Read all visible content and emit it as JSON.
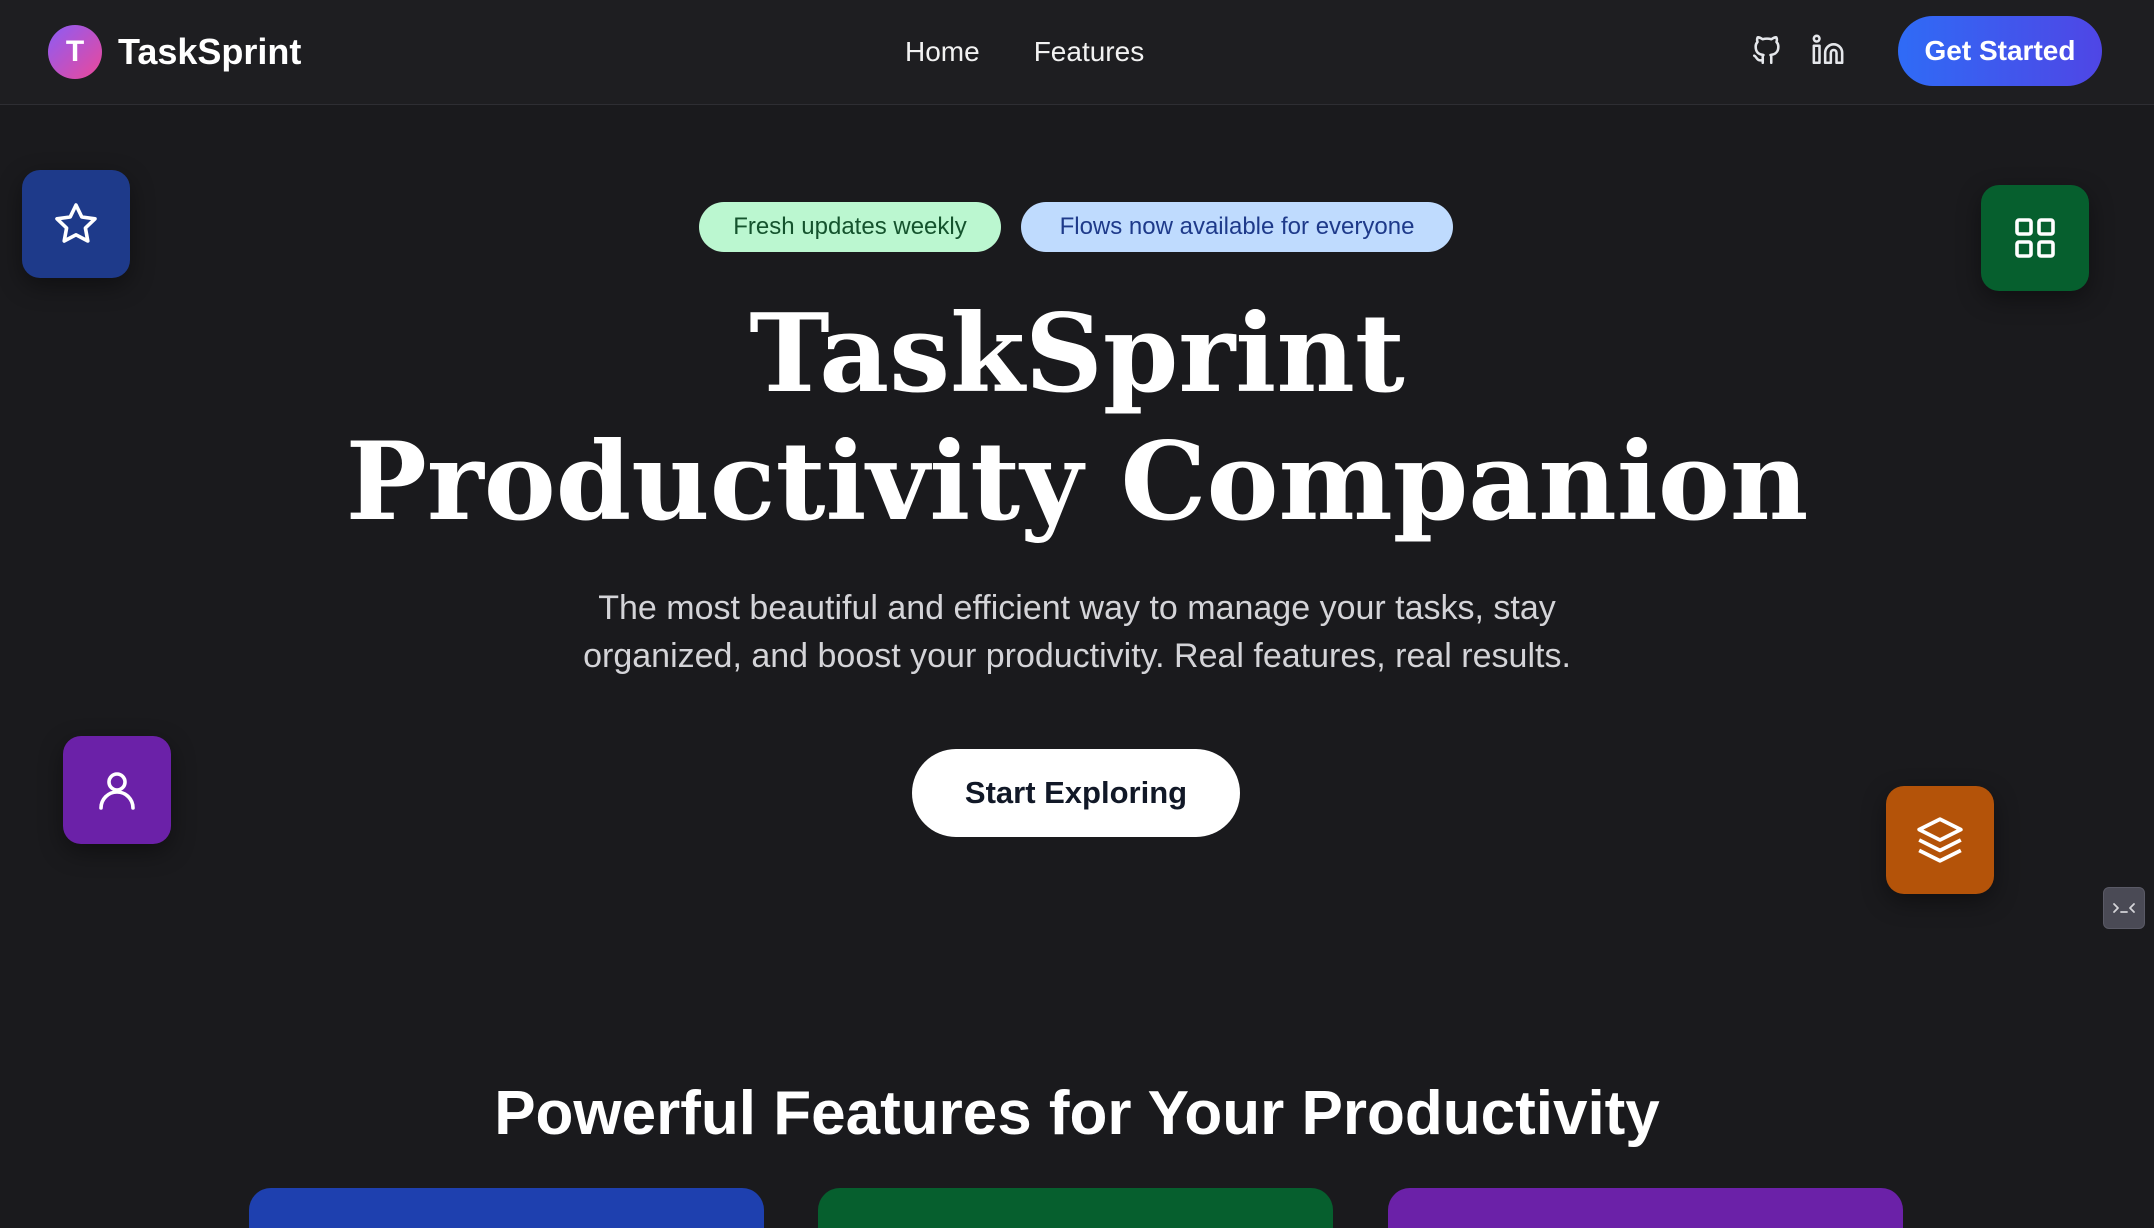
{
  "header": {
    "logo_letter": "T",
    "brand": "TaskSprint",
    "nav": [
      "Home",
      "Features"
    ],
    "icons": [
      "github-icon",
      "linkedin-icon"
    ],
    "cta_label": "Get Started"
  },
  "hero": {
    "badges": [
      {
        "label": "Fresh updates weekly",
        "bg": "#bbf7d0",
        "fg": "#14532d"
      },
      {
        "label": "Flows now available for everyone",
        "bg": "#bfdbfe",
        "fg": "#1e3a8a"
      }
    ],
    "title_line1": "TaskSprint",
    "title_line2": "Productivity Companion",
    "subtitle": "The most beautiful and efficient way to manage your tasks, stay organized, and boost your productivity. Real features, real results.",
    "button_label": "Start Exploring"
  },
  "floating_tiles": [
    {
      "icon": "star-icon",
      "color": "#1e3a8a"
    },
    {
      "icon": "grid-icon",
      "color": "#065f2e"
    },
    {
      "icon": "user-icon",
      "color": "#6b21a8"
    },
    {
      "icon": "layers-icon",
      "color": "#b45309"
    }
  ],
  "features": {
    "title": "Powerful Features for Your Productivity",
    "card_colors": [
      "#1e40af",
      "#065f2e",
      "#6b21a8"
    ]
  },
  "colors": {
    "background": "#1a1a1d",
    "navbar": "#1e1e21",
    "accent": "#2f6bf6"
  }
}
